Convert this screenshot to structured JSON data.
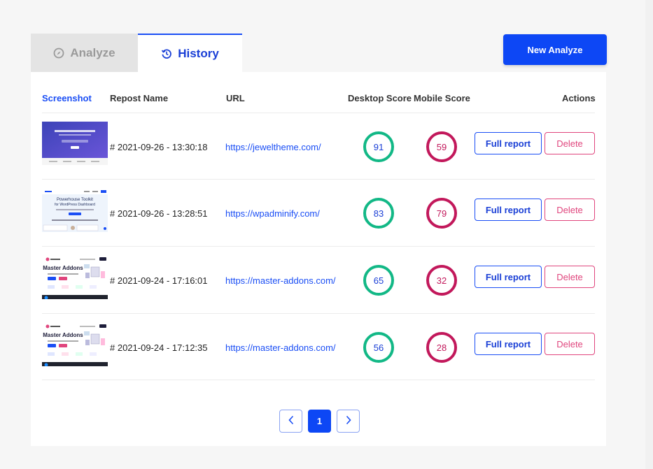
{
  "tabs": {
    "analyze_label": "Analyze",
    "history_label": "History",
    "new_analyze_label": "New Analyze"
  },
  "table": {
    "headers": {
      "screenshot": "Screenshot",
      "report_name": "Repost Name",
      "url": "URL",
      "desktop_score": "Desktop Score",
      "mobile_score": "Mobile Score",
      "actions": "Actions"
    },
    "full_report_label": "Full report",
    "delete_label": "Delete",
    "rows": [
      {
        "name": "# 2021-09-26  -  13:30:18",
        "url": "https://jeweltheme.com/",
        "desktop": "91",
        "mobile": "59",
        "thumb": "jeweltheme"
      },
      {
        "name": "# 2021-09-26  -  13:28:51",
        "url": "https://wpadminify.com/",
        "desktop": "83",
        "mobile": "79",
        "thumb": "wpadminify"
      },
      {
        "name": "# 2021-09-24  -  17:16:01",
        "url": "https://master-addons.com/",
        "desktop": "65",
        "mobile": "32",
        "thumb": "master-addons"
      },
      {
        "name": "# 2021-09-24  -  17:12:35",
        "url": "https://master-addons.com/",
        "desktop": "56",
        "mobile": "28",
        "thumb": "master-addons"
      }
    ]
  },
  "thumbs": {
    "wpadminify_text1": "Powerhouse Toolkit",
    "wpadminify_text2": "for WordPress Dashboard",
    "master_title": "Master Addons"
  },
  "pagination": {
    "current_page": "1"
  },
  "colors": {
    "accent": "#0d47f5",
    "desktop_ring": "#12b886",
    "mobile_ring": "#c2185b",
    "delete": "#e0457d"
  }
}
